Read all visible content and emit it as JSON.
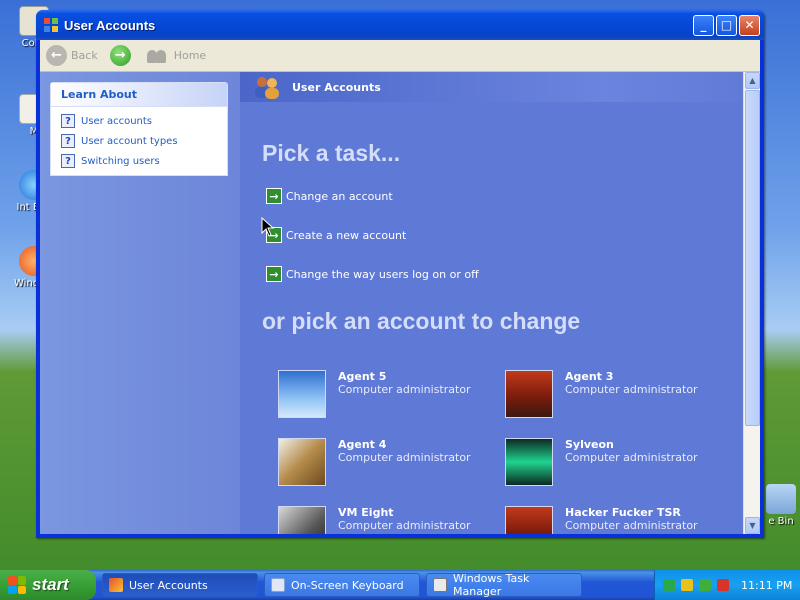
{
  "desktop": {
    "icons": [
      {
        "label": "Colle",
        "icon": "collection-icon"
      },
      {
        "label": "M",
        "icon": "my-documents-icon"
      },
      {
        "label": "Int Exp",
        "icon": "internet-explorer-icon"
      },
      {
        "label": "Windo Pl",
        "icon": "media-player-icon"
      },
      {
        "label": "e Bin",
        "icon": "recycle-bin-icon"
      }
    ]
  },
  "window": {
    "title": "User Accounts",
    "toolbar": {
      "back": "Back",
      "home": "Home"
    },
    "learn_about": {
      "heading": "Learn About",
      "items": [
        "User accounts",
        "User account types",
        "Switching users"
      ]
    },
    "banner": {
      "title": "User Accounts"
    },
    "pick_task_heading": "Pick a task...",
    "tasks": [
      "Change an account",
      "Create a new account",
      "Change the way users log on or off"
    ],
    "pick_account_heading": "or pick an account to change",
    "accounts": [
      {
        "name": "Agent 5",
        "role": "Computer administrator",
        "picture": "airplane"
      },
      {
        "name": "Agent 3",
        "role": "Computer administrator",
        "picture": "chess"
      },
      {
        "name": "Agent 4",
        "role": "Computer administrator",
        "picture": "guitar"
      },
      {
        "name": "Sylveon",
        "role": "Computer administrator",
        "picture": "green-abstract"
      },
      {
        "name": "VM Eight",
        "role": "Computer administrator",
        "picture": "horse"
      },
      {
        "name": "Hacker Fucker TSR",
        "role": "Computer administrator",
        "picture": "chess"
      }
    ]
  },
  "taskbar": {
    "start_label": "start",
    "buttons": [
      "User Accounts",
      "On-Screen Keyboard",
      "Windows Task Manager"
    ],
    "clock": "11:11 PM"
  },
  "colors": {
    "main_bg": "#5f79d6",
    "left_pane": "#7b97e0",
    "accent_link": "#215dc6",
    "taskbar": "#245edb",
    "start_green": "#37a035"
  }
}
